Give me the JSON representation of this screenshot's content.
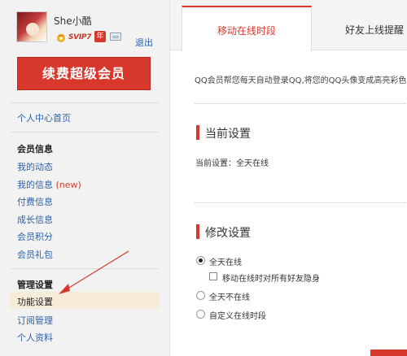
{
  "profile": {
    "username": "She小酷",
    "vip_badge": "SVIP7",
    "year_badge": "年",
    "logout_label": "退出"
  },
  "renew_button": "续费超级会员",
  "nav": {
    "home": "个人中心首页",
    "member_info_heading": "会员信息",
    "my_activity": "我的动态",
    "my_info": "我的信息",
    "new_tag": "(new)",
    "paid_info": "付费信息",
    "growth_info": "成长信息",
    "member_points": "会员积分",
    "member_gifts": "会员礼包",
    "manage_heading": "管理设置",
    "feature_settings": "功能设置",
    "subscription_manage": "订阅管理",
    "personal_profile": "个人资料"
  },
  "tabs": [
    {
      "label": "移动在线时段",
      "active": true
    },
    {
      "label": "好友上线提醒",
      "active": false
    }
  ],
  "intro_text": "QQ会员帮您每天自动登录QQ,将您的QQ头像变成高亮彩色",
  "current": {
    "title": "当前设置",
    "text": "当前设置：全天在线"
  },
  "modify": {
    "title": "修改设置",
    "options": [
      {
        "label": "全天在线",
        "selected": true
      },
      {
        "label": "全天不在线",
        "selected": false
      },
      {
        "label": "自定义在线时段",
        "selected": false
      }
    ],
    "hide_checkbox_label": "移动在线时对所有好友隐身",
    "hide_checked": false
  },
  "colors": {
    "accent": "#d8372b",
    "link": "#2c63a8",
    "selected_nav_bg": "#f7ecd8"
  }
}
